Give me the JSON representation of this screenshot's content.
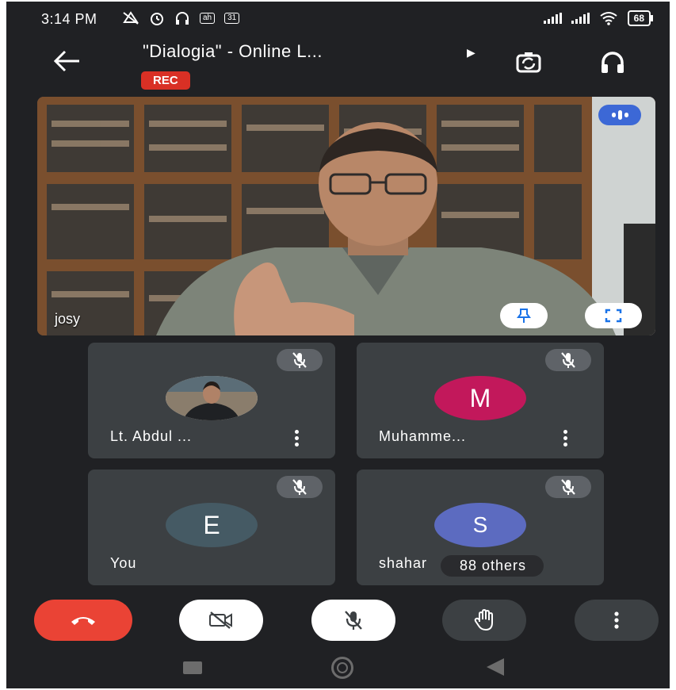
{
  "status_bar": {
    "time": "3:14 PM",
    "calendar_day": "31",
    "battery": "68"
  },
  "header": {
    "back_icon": "arrow-left-icon",
    "title": "\"Dialogia\" - Online L...",
    "rec_badge": "REC",
    "camera_switch_icon": "camera-switch-icon",
    "audio_icon": "headphones-icon"
  },
  "main_video": {
    "participant_name": "josy",
    "speaking_icon": "speaking-indicator-icon",
    "pin_icon": "pin-icon",
    "fullscreen_icon": "fullscreen-icon"
  },
  "participants": [
    {
      "name": "Lt. Abdul ...",
      "avatar_type": "photo",
      "avatar_letter": "",
      "avatar_color": "#e6e6e6",
      "muted": true,
      "has_menu": true
    },
    {
      "name": "Muhamme...",
      "avatar_type": "letter",
      "avatar_letter": "M",
      "avatar_color": "#c2185b",
      "muted": true,
      "has_menu": true
    },
    {
      "name": "You",
      "avatar_type": "letter",
      "avatar_letter": "E",
      "avatar_color": "#455a64",
      "muted": true,
      "has_menu": false
    },
    {
      "name": "shahar",
      "avatar_type": "letter",
      "avatar_letter": "S",
      "avatar_color": "#5c6bc0",
      "muted": true,
      "has_menu": false,
      "others_label": "88 others"
    }
  ],
  "controls": {
    "end_call_icon": "end-call-icon",
    "camera_off_icon": "camera-off-icon",
    "mic_off_icon": "mic-off-icon",
    "raise_hand_icon": "raise-hand-icon",
    "more_icon": "more-vertical-icon",
    "colors": {
      "end_call": "#ea4335",
      "active_toggle": "#ffffff",
      "neutral": "#3c4043"
    }
  }
}
